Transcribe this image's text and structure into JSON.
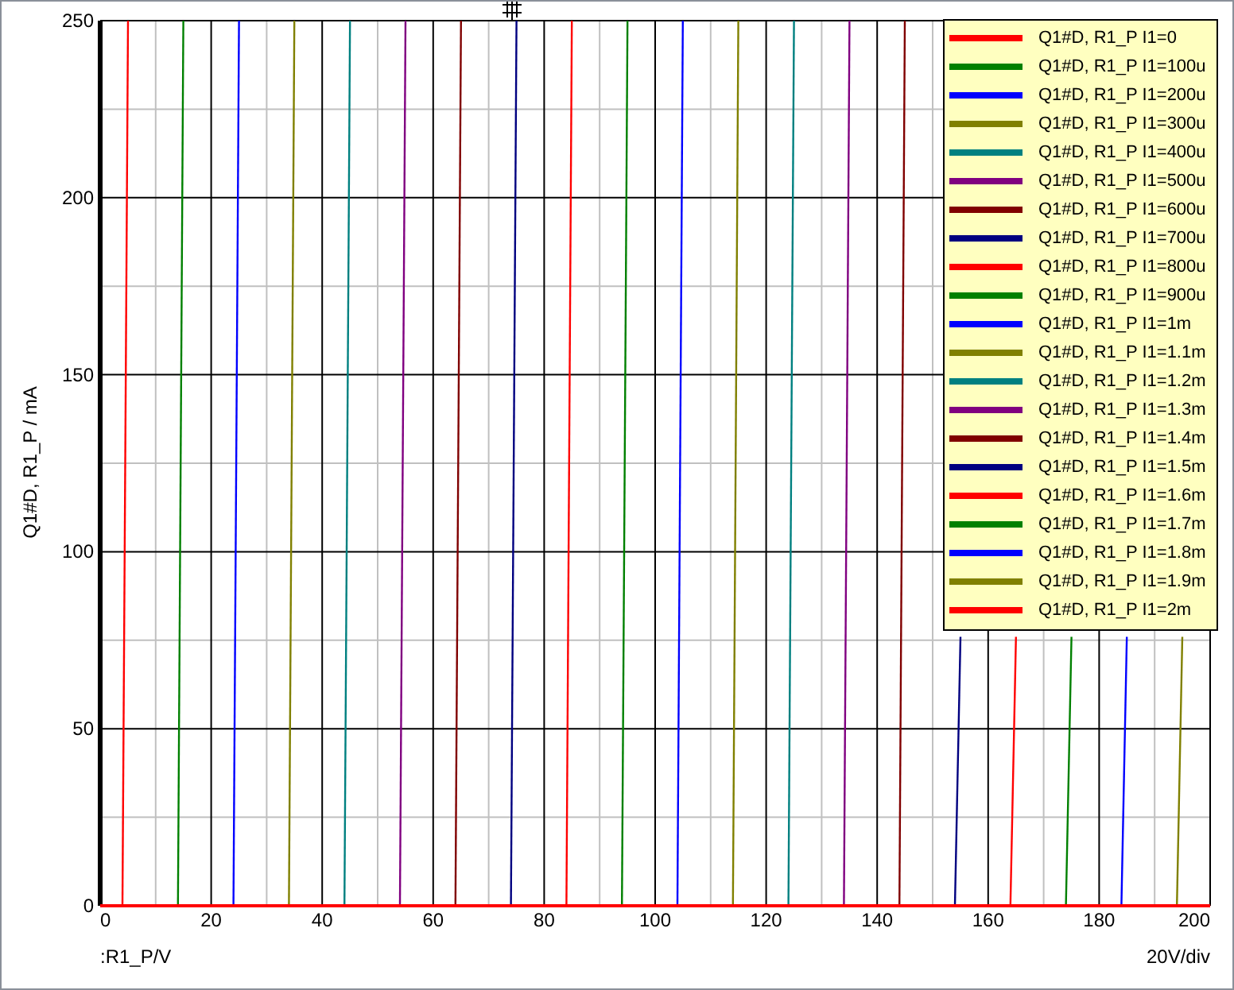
{
  "chart": {
    "chart_data": {
      "type": "line",
      "grid": true,
      "xlabel": ":R1_P/V",
      "ylabel": "Q1#D, R1_P / mA",
      "xlim": [
        0,
        200
      ],
      "ylim": [
        0,
        250
      ],
      "xticks": [
        0,
        20,
        40,
        60,
        80,
        100,
        120,
        140,
        160,
        180,
        200
      ],
      "yticks": [
        0,
        50,
        100,
        150,
        200,
        250
      ],
      "x": [
        0,
        4,
        5,
        14,
        15,
        24,
        25,
        34,
        35,
        44,
        45,
        54,
        55,
        64,
        65,
        74,
        75,
        84,
        85,
        94,
        95,
        104,
        105,
        114,
        115,
        124,
        125,
        134,
        135,
        144,
        145,
        154,
        155,
        164,
        165,
        174,
        175,
        184,
        185,
        194,
        195,
        200
      ],
      "series": [
        {
          "name": "Q1#D, R1_P I1=0",
          "color": "#ff0000",
          "values": [
            null,
            0,
            250,
            null,
            null,
            null,
            null,
            null,
            null,
            null,
            null,
            null,
            null,
            null,
            null,
            null,
            null,
            null,
            null,
            null,
            null,
            null,
            null,
            null,
            null,
            null,
            null,
            null,
            null,
            null,
            null,
            null,
            null,
            null,
            null,
            null,
            null,
            null,
            null,
            null,
            null,
            null
          ]
        },
        {
          "name": "Q1#D, R1_P I1=100u",
          "color": "#008000",
          "values": [
            null,
            null,
            null,
            0,
            250,
            null,
            null,
            null,
            null,
            null,
            null,
            null,
            null,
            null,
            null,
            null,
            null,
            null,
            null,
            null,
            null,
            null,
            null,
            null,
            null,
            null,
            null,
            null,
            null,
            null,
            null,
            null,
            null,
            null,
            null,
            null,
            null,
            null,
            null,
            null,
            null,
            null
          ]
        },
        {
          "name": "Q1#D, R1_P I1=200u",
          "color": "#0000ff",
          "values": [
            null,
            null,
            null,
            null,
            null,
            0,
            250,
            null,
            null,
            null,
            null,
            null,
            null,
            null,
            null,
            null,
            null,
            null,
            null,
            null,
            null,
            null,
            null,
            null,
            null,
            null,
            null,
            null,
            null,
            null,
            null,
            null,
            null,
            null,
            null,
            null,
            null,
            null,
            null,
            null,
            null,
            null
          ]
        },
        {
          "name": "Q1#D, R1_P I1=300u",
          "color": "#808000",
          "values": [
            null,
            null,
            null,
            null,
            null,
            null,
            null,
            0,
            250,
            null,
            null,
            null,
            null,
            null,
            null,
            null,
            null,
            null,
            null,
            null,
            null,
            null,
            null,
            null,
            null,
            null,
            null,
            null,
            null,
            null,
            null,
            null,
            null,
            null,
            null,
            null,
            null,
            null,
            null,
            null,
            null,
            null
          ]
        },
        {
          "name": "Q1#D, R1_P I1=400u",
          "color": "#008080",
          "values": [
            null,
            null,
            null,
            null,
            null,
            null,
            null,
            null,
            null,
            0,
            250,
            null,
            null,
            null,
            null,
            null,
            null,
            null,
            null,
            null,
            null,
            null,
            null,
            null,
            null,
            null,
            null,
            null,
            null,
            null,
            null,
            null,
            null,
            null,
            null,
            null,
            null,
            null,
            null,
            null,
            null,
            null
          ]
        },
        {
          "name": "Q1#D, R1_P I1=500u",
          "color": "#800080",
          "values": [
            null,
            null,
            null,
            null,
            null,
            null,
            null,
            null,
            null,
            null,
            null,
            0,
            250,
            null,
            null,
            null,
            null,
            null,
            null,
            null,
            null,
            null,
            null,
            null,
            null,
            null,
            null,
            null,
            null,
            null,
            null,
            null,
            null,
            null,
            null,
            null,
            null,
            null,
            null,
            null,
            null,
            null
          ]
        },
        {
          "name": "Q1#D, R1_P I1=600u",
          "color": "#800000",
          "values": [
            null,
            null,
            null,
            null,
            null,
            null,
            null,
            null,
            null,
            null,
            null,
            null,
            null,
            0,
            250,
            null,
            null,
            null,
            null,
            null,
            null,
            null,
            null,
            null,
            null,
            null,
            null,
            null,
            null,
            null,
            null,
            null,
            null,
            null,
            null,
            null,
            null,
            null,
            null,
            null,
            null,
            null
          ]
        },
        {
          "name": "Q1#D, R1_P I1=700u",
          "color": "#000080",
          "values": [
            null,
            null,
            null,
            null,
            null,
            null,
            null,
            null,
            null,
            null,
            null,
            null,
            null,
            null,
            null,
            0,
            250,
            null,
            null,
            null,
            null,
            null,
            null,
            null,
            null,
            null,
            null,
            null,
            null,
            null,
            null,
            null,
            null,
            null,
            null,
            null,
            null,
            null,
            null,
            null,
            null,
            null
          ]
        },
        {
          "name": "Q1#D, R1_P I1=800u",
          "color": "#ff0000",
          "values": [
            null,
            null,
            null,
            null,
            null,
            null,
            null,
            null,
            null,
            null,
            null,
            null,
            null,
            null,
            null,
            null,
            null,
            0,
            250,
            null,
            null,
            null,
            null,
            null,
            null,
            null,
            null,
            null,
            null,
            null,
            null,
            null,
            null,
            null,
            null,
            null,
            null,
            null,
            null,
            null,
            null,
            null
          ]
        },
        {
          "name": "Q1#D, R1_P I1=900u",
          "color": "#008000",
          "values": [
            null,
            null,
            null,
            null,
            null,
            null,
            null,
            null,
            null,
            null,
            null,
            null,
            null,
            null,
            null,
            null,
            null,
            null,
            null,
            0,
            250,
            null,
            null,
            null,
            null,
            null,
            null,
            null,
            null,
            null,
            null,
            null,
            null,
            null,
            null,
            null,
            null,
            null,
            null,
            null,
            null,
            null
          ]
        },
        {
          "name": "Q1#D, R1_P I1=1m",
          "color": "#0000ff",
          "values": [
            null,
            null,
            null,
            null,
            null,
            null,
            null,
            null,
            null,
            null,
            null,
            null,
            null,
            null,
            null,
            null,
            null,
            null,
            null,
            null,
            null,
            0,
            250,
            null,
            null,
            null,
            null,
            null,
            null,
            null,
            null,
            null,
            null,
            null,
            null,
            null,
            null,
            null,
            null,
            null,
            null,
            null
          ]
        },
        {
          "name": "Q1#D, R1_P I1=1.1m",
          "color": "#808000",
          "values": [
            null,
            null,
            null,
            null,
            null,
            null,
            null,
            null,
            null,
            null,
            null,
            null,
            null,
            null,
            null,
            null,
            null,
            null,
            null,
            null,
            null,
            null,
            null,
            0,
            250,
            null,
            null,
            null,
            null,
            null,
            null,
            null,
            null,
            null,
            null,
            null,
            null,
            null,
            null,
            null,
            null,
            null
          ]
        },
        {
          "name": "Q1#D, R1_P I1=1.2m",
          "color": "#008080",
          "values": [
            null,
            null,
            null,
            null,
            null,
            null,
            null,
            null,
            null,
            null,
            null,
            null,
            null,
            null,
            null,
            null,
            null,
            null,
            null,
            null,
            null,
            null,
            null,
            null,
            null,
            0,
            250,
            null,
            null,
            null,
            null,
            null,
            null,
            null,
            null,
            null,
            null,
            null,
            null,
            null,
            null,
            null
          ]
        },
        {
          "name": "Q1#D, R1_P I1=1.3m",
          "color": "#800080",
          "values": [
            null,
            null,
            null,
            null,
            null,
            null,
            null,
            null,
            null,
            null,
            null,
            null,
            null,
            null,
            null,
            null,
            null,
            null,
            null,
            null,
            null,
            null,
            null,
            null,
            null,
            null,
            null,
            0,
            250,
            null,
            null,
            null,
            null,
            null,
            null,
            null,
            null,
            null,
            null,
            null,
            null,
            null
          ]
        },
        {
          "name": "Q1#D, R1_P I1=1.4m",
          "color": "#800000",
          "values": [
            null,
            null,
            null,
            null,
            null,
            null,
            null,
            null,
            null,
            null,
            null,
            null,
            null,
            null,
            null,
            null,
            null,
            null,
            null,
            null,
            null,
            null,
            null,
            null,
            null,
            null,
            null,
            null,
            null,
            0,
            250,
            null,
            null,
            null,
            null,
            null,
            null,
            null,
            null,
            null,
            null,
            null
          ]
        },
        {
          "name": "Q1#D, R1_P I1=1.5m",
          "color": "#000080",
          "values": [
            null,
            null,
            null,
            null,
            null,
            null,
            null,
            null,
            null,
            null,
            null,
            null,
            null,
            null,
            null,
            null,
            null,
            null,
            null,
            null,
            null,
            null,
            null,
            null,
            null,
            null,
            null,
            null,
            null,
            null,
            null,
            0,
            76,
            null,
            null,
            null,
            null,
            null,
            null,
            null,
            null,
            null
          ]
        },
        {
          "name": "Q1#D, R1_P I1=1.6m",
          "color": "#ff0000",
          "values": [
            null,
            null,
            null,
            null,
            null,
            null,
            null,
            null,
            null,
            null,
            null,
            null,
            null,
            null,
            null,
            null,
            null,
            null,
            null,
            null,
            null,
            null,
            null,
            null,
            null,
            null,
            null,
            null,
            null,
            null,
            null,
            null,
            null,
            0,
            76,
            null,
            null,
            null,
            null,
            null,
            null,
            null
          ]
        },
        {
          "name": "Q1#D, R1_P I1=1.7m",
          "color": "#008000",
          "values": [
            null,
            null,
            null,
            null,
            null,
            null,
            null,
            null,
            null,
            null,
            null,
            null,
            null,
            null,
            null,
            null,
            null,
            null,
            null,
            null,
            null,
            null,
            null,
            null,
            null,
            null,
            null,
            null,
            null,
            null,
            null,
            null,
            null,
            null,
            null,
            0,
            76,
            null,
            null,
            null,
            null,
            null
          ]
        },
        {
          "name": "Q1#D, R1_P I1=1.8m",
          "color": "#0000ff",
          "values": [
            null,
            null,
            null,
            null,
            null,
            null,
            null,
            null,
            null,
            null,
            null,
            null,
            null,
            null,
            null,
            null,
            null,
            null,
            null,
            null,
            null,
            null,
            null,
            null,
            null,
            null,
            null,
            null,
            null,
            null,
            null,
            null,
            null,
            null,
            null,
            null,
            null,
            0,
            76,
            null,
            null,
            null
          ]
        },
        {
          "name": "Q1#D, R1_P I1=1.9m",
          "color": "#808000",
          "values": [
            null,
            null,
            null,
            null,
            null,
            null,
            null,
            null,
            null,
            null,
            null,
            null,
            null,
            null,
            null,
            null,
            null,
            null,
            null,
            null,
            null,
            null,
            null,
            null,
            null,
            null,
            null,
            null,
            null,
            null,
            null,
            null,
            null,
            null,
            null,
            null,
            null,
            null,
            null,
            0,
            76,
            null
          ]
        },
        {
          "name": "Q1#D, R1_P I1=2m",
          "color": "#ff0000",
          "values": [
            0,
            0,
            0,
            0,
            0,
            0,
            0,
            0,
            0,
            0,
            0,
            0,
            0,
            0,
            0,
            0,
            0,
            0,
            0,
            0,
            0,
            0,
            0,
            0,
            0,
            0,
            0,
            0,
            0,
            0,
            0,
            0,
            0,
            0,
            0,
            0,
            0,
            0,
            0,
            0,
            0,
            0
          ]
        }
      ]
    },
    "scale_label": "20V/div"
  }
}
